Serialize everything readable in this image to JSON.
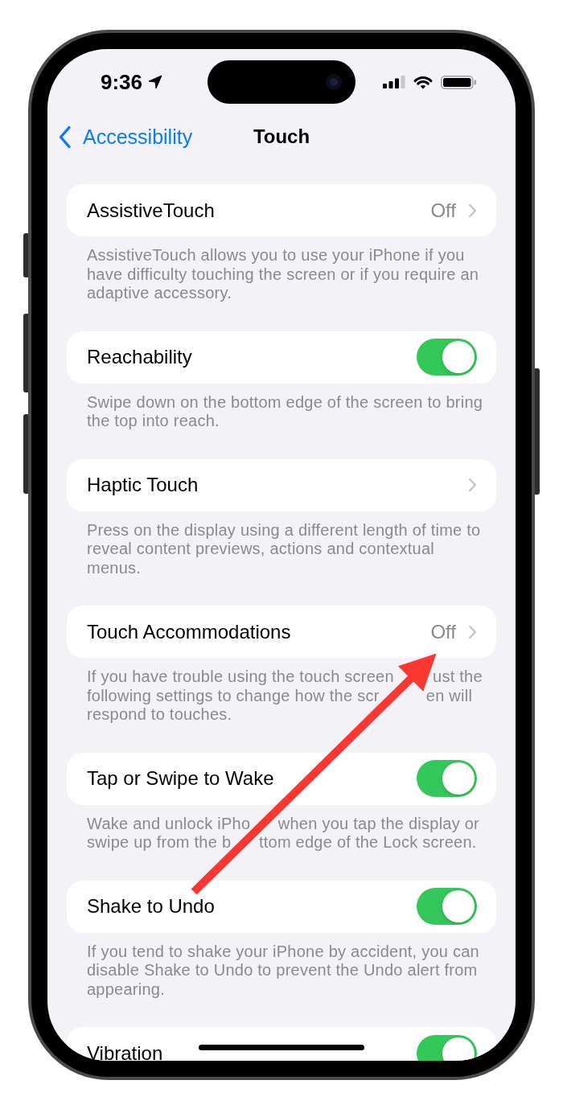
{
  "status_bar": {
    "time": "9:36"
  },
  "nav_bar": {
    "back_label": "Accessibility",
    "title": "Touch"
  },
  "settings": [
    {
      "kind": "link",
      "label": "AssistiveTouch",
      "value": "Off",
      "footer": [
        "AssistiveTouch allows you to use your iPhone if you have difficulty touching the screen or if you require an adaptive accessory."
      ]
    },
    {
      "kind": "toggle",
      "label": "Reachability",
      "on": true,
      "footer": [
        "Swipe down on the bottom edge of the screen to bring the top into reach."
      ]
    },
    {
      "kind": "link",
      "label": "Haptic Touch",
      "footer": [
        "Press on the display using a different length of time to reveal content previews, actions and contextual menus."
      ]
    },
    {
      "kind": "link",
      "label": "Touch Accommodations",
      "value": "Off",
      "footer": [
        "If you have trouble using the touch screen",
        "ust the following settings to change how the scr",
        "en will respond to touches."
      ]
    },
    {
      "kind": "toggle",
      "label": "Tap or Swipe to Wake",
      "on": true,
      "footer": [
        "Wake and unlock iPho",
        "when you tap the display or swipe up from the b",
        "ttom edge of the Lock screen."
      ]
    },
    {
      "kind": "toggle",
      "label": "Shake to Undo",
      "on": true,
      "footer": [
        "If you tend to shake your iPhone by accident, you can disable Shake to Undo to prevent the Undo alert from appearing."
      ]
    },
    {
      "kind": "toggle",
      "label": "Vibration",
      "on": true
    }
  ]
}
